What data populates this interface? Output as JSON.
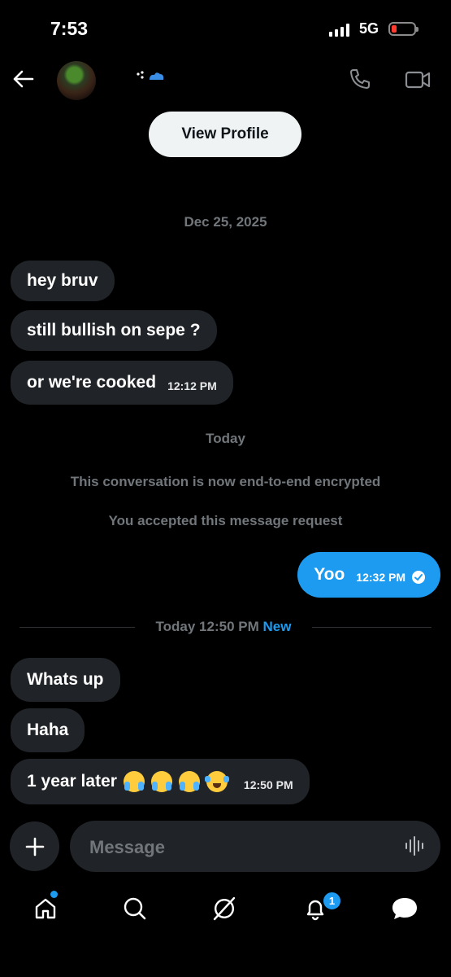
{
  "status_bar": {
    "time": "7:53",
    "network": "5G",
    "battery_color": "#ff3b30"
  },
  "header": {
    "back_icon": "arrow-left-icon",
    "call_icon": "phone-icon",
    "video_icon": "video-camera-icon",
    "view_profile_label": "View Profile"
  },
  "conversation": {
    "date_first": "Dec 25, 2025",
    "incoming_1": [
      {
        "text": "hey bruv"
      },
      {
        "text": "still bullish on sepe ?"
      },
      {
        "text": "or we're cooked",
        "time": "12:12 PM"
      }
    ],
    "date_today": "Today",
    "system_messages": [
      "This conversation is now end-to-end encrypted",
      "You accepted this message request"
    ],
    "outgoing": {
      "text": "Yoo",
      "time": "12:32 PM",
      "status_icon": "check-circle-icon"
    },
    "divider": {
      "label": "Today 12:50 PM",
      "new_label": "New"
    },
    "incoming_2": [
      {
        "text": "Whats up"
      },
      {
        "text": "Haha"
      },
      {
        "text": "1 year later",
        "time": "12:50 PM",
        "emojis": [
          "loudly-crying-face",
          "loudly-crying-face",
          "loudly-crying-face",
          "tears-of-joy-face"
        ]
      }
    ]
  },
  "composer": {
    "placeholder": "Message",
    "add_icon": "plus-icon",
    "voice_icon": "waveform-icon"
  },
  "bottom_nav": {
    "items": [
      "home-icon",
      "search-icon",
      "grok-icon",
      "notifications-icon",
      "messages-icon"
    ],
    "notification_count": "1",
    "accent": "#1d9bf0"
  }
}
